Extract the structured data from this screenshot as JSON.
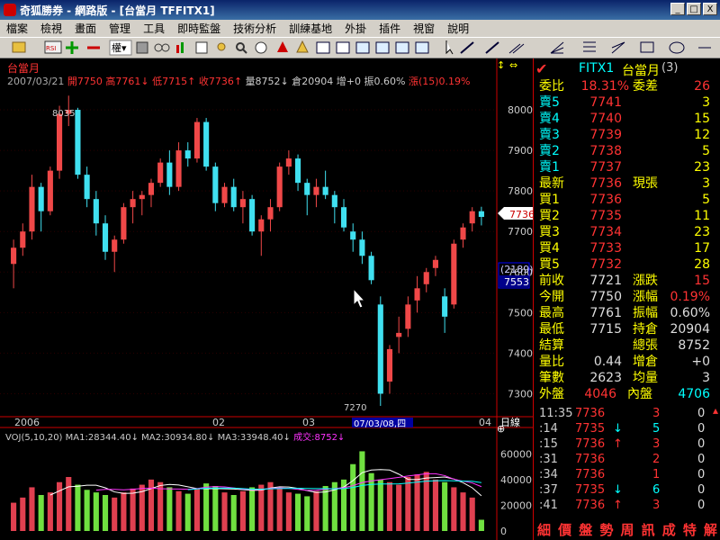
{
  "window": {
    "title": "奇狐勝券 - 網路版 - [台當月 TFFITX1]",
    "btn_min": "_",
    "btn_max": "□",
    "btn_close": "X"
  },
  "menu": {
    "items": [
      "檔案",
      "檢視",
      "畫面",
      "管理",
      "工具",
      "即時監盤",
      "技術分析",
      "訓練基地",
      "外掛",
      "插件",
      "視窗",
      "說明"
    ],
    "toolbar_select": "權▾"
  },
  "chart": {
    "product_label": "台當月",
    "info": {
      "date": "2007/03/21",
      "open": "開7750",
      "high": "高7761↓",
      "low": "低7715↑",
      "close": "收7736↑",
      "volume": "量8752↓",
      "oi": "倉20904",
      "oi_delta": "增+0",
      "amplitude": "振0.60%",
      "change": "漲(15)0.19%"
    },
    "y_labels": [
      "8000",
      "7900",
      "7800",
      "7700",
      "7600",
      "7500",
      "7400",
      "7300"
    ],
    "current_price_label": "7736",
    "diff_label": "(2189)",
    "diff_value": "7553",
    "high_mark": "8035",
    "low_mark": "7270",
    "x_labels": [
      "2006",
      "02",
      "03",
      "04"
    ],
    "cursor_date": "07/03/08,四",
    "period_label": "日線"
  },
  "volume_panel": {
    "indicator": "VOJ(5,10,20)",
    "ma1": "MA1:28344.40↓",
    "ma2": "MA2:30934.80↓",
    "ma3": "MA3:33948.40↓",
    "vol": "成交:8752↓",
    "y_labels": [
      "60000",
      "40000",
      "20000",
      "0"
    ]
  },
  "colors": {
    "up": "#f04848",
    "down": "#40e0f0",
    "vol_up": "#e04050",
    "vol_down": "#70e040"
  },
  "chart_data": {
    "type": "candlestick",
    "title": "台當月",
    "ylim": [
      7250,
      8060
    ],
    "candles": [
      [
        7620,
        7680,
        7560,
        7660
      ],
      [
        7660,
        7720,
        7640,
        7700
      ],
      [
        7700,
        7840,
        7680,
        7810
      ],
      [
        7810,
        7820,
        7700,
        7750
      ],
      [
        7750,
        7860,
        7740,
        7850
      ],
      [
        7850,
        8010,
        7830,
        7990
      ],
      [
        7990,
        8035,
        7960,
        8000
      ],
      [
        8000,
        8005,
        7830,
        7840
      ],
      [
        7840,
        7860,
        7760,
        7780
      ],
      [
        7780,
        7800,
        7690,
        7720
      ],
      [
        7720,
        7740,
        7630,
        7650
      ],
      [
        7650,
        7690,
        7600,
        7680
      ],
      [
        7680,
        7770,
        7670,
        7760
      ],
      [
        7760,
        7800,
        7720,
        7780
      ],
      [
        7780,
        7800,
        7740,
        7790
      ],
      [
        7790,
        7830,
        7760,
        7820
      ],
      [
        7820,
        7880,
        7810,
        7870
      ],
      [
        7870,
        7900,
        7790,
        7810
      ],
      [
        7810,
        7920,
        7800,
        7900
      ],
      [
        7900,
        7920,
        7860,
        7880
      ],
      [
        7880,
        7980,
        7870,
        7970
      ],
      [
        7970,
        7980,
        7850,
        7860
      ],
      [
        7860,
        7870,
        7750,
        7770
      ],
      [
        7770,
        7820,
        7760,
        7810
      ],
      [
        7810,
        7830,
        7750,
        7760
      ],
      [
        7760,
        7800,
        7720,
        7780
      ],
      [
        7780,
        7790,
        7690,
        7700
      ],
      [
        7700,
        7740,
        7640,
        7730
      ],
      [
        7730,
        7780,
        7700,
        7760
      ],
      [
        7760,
        7870,
        7750,
        7860
      ],
      [
        7860,
        7900,
        7840,
        7880
      ],
      [
        7880,
        7890,
        7800,
        7820
      ],
      [
        7820,
        7830,
        7740,
        7790
      ],
      [
        7790,
        7830,
        7760,
        7810
      ],
      [
        7810,
        7850,
        7780,
        7790
      ],
      [
        7790,
        7800,
        7720,
        7760
      ],
      [
        7760,
        7780,
        7700,
        7710
      ],
      [
        7700,
        7720,
        7650,
        7680
      ],
      [
        7680,
        7700,
        7620,
        7640
      ],
      [
        7640,
        7650,
        7570,
        7580
      ],
      [
        7520,
        7540,
        7270,
        7300
      ],
      [
        7330,
        7420,
        7300,
        7410
      ],
      [
        7440,
        7490,
        7400,
        7450
      ],
      [
        7460,
        7540,
        7440,
        7520
      ],
      [
        7530,
        7590,
        7500,
        7560
      ],
      [
        7570,
        7610,
        7550,
        7600
      ],
      [
        7610,
        7640,
        7590,
        7630
      ],
      [
        7540,
        7560,
        7450,
        7490
      ],
      [
        7520,
        7680,
        7510,
        7670
      ],
      [
        7680,
        7720,
        7660,
        7710
      ],
      [
        7720,
        7760,
        7700,
        7750
      ],
      [
        7750,
        7761,
        7715,
        7736
      ]
    ],
    "volumes": [
      22000,
      26000,
      34000,
      28000,
      30000,
      38000,
      42000,
      36000,
      32000,
      30000,
      28000,
      26000,
      30000,
      33000,
      36000,
      40000,
      38000,
      34000,
      31000,
      29000,
      33000,
      37000,
      35000,
      30000,
      28000,
      31000,
      34000,
      36000,
      38000,
      33000,
      30000,
      29000,
      27000,
      31000,
      35000,
      38000,
      40000,
      52000,
      62000,
      45000,
      40000,
      38000,
      36000,
      42000,
      44000,
      46000,
      40000,
      38000,
      34000,
      30000,
      26000,
      8752
    ]
  },
  "panel": {
    "product_code": "FITX1",
    "product_name": "台當月",
    "product_count": "(3)",
    "weibi_label": "委比",
    "weibi_value": "18.31%",
    "weicha_label": "委差",
    "weicha_value": "26",
    "asks": [
      {
        "label": "賣5",
        "price": "7741",
        "qty": "3"
      },
      {
        "label": "賣4",
        "price": "7740",
        "qty": "15"
      },
      {
        "label": "賣3",
        "price": "7739",
        "qty": "12"
      },
      {
        "label": "賣2",
        "price": "7738",
        "qty": "5"
      },
      {
        "label": "賣1",
        "price": "7737",
        "qty": "23"
      }
    ],
    "last_label": "最新",
    "last_price": "7736",
    "cur_vol_label": "現張",
    "cur_vol": "3",
    "bids": [
      {
        "label": "買1",
        "price": "7736",
        "qty": "5"
      },
      {
        "label": "買2",
        "price": "7735",
        "qty": "11"
      },
      {
        "label": "買3",
        "price": "7734",
        "qty": "23"
      },
      {
        "label": "買4",
        "price": "7733",
        "qty": "17"
      },
      {
        "label": "買5",
        "price": "7732",
        "qty": "28"
      }
    ],
    "stats": [
      {
        "l": "前收",
        "v": "7721",
        "l2": "漲跌",
        "v2": "15"
      },
      {
        "l": "今開",
        "v": "7750",
        "l2": "漲幅",
        "v2": "0.19%"
      },
      {
        "l": "最高",
        "v": "7761",
        "l2": "振幅",
        "v2": "0.60%"
      },
      {
        "l": "最低",
        "v": "7715",
        "l2": "持倉",
        "v2": "20904"
      },
      {
        "l": "結算",
        "v": "",
        "l2": "總張",
        "v2": "8752"
      },
      {
        "l": "量比",
        "v": "0.44",
        "l2": "增倉",
        "v2": "+0"
      },
      {
        "l": "筆數",
        "v": "2623",
        "l2": "均量",
        "v2": "3"
      }
    ],
    "outer_label": "外盤",
    "outer_value": "4046",
    "inner_label": "內盤",
    "inner_value": "4706",
    "ticks": [
      {
        "time": "11:35",
        "price": "7736",
        "arrow": "",
        "vol": "3",
        "x": "0"
      },
      {
        "time": ":14",
        "price": "7735",
        "arrow": "↓",
        "vol": "5",
        "x": "0"
      },
      {
        "time": ":15",
        "price": "7736",
        "arrow": "↑",
        "vol": "3",
        "x": "0"
      },
      {
        "time": ":31",
        "price": "7736",
        "arrow": "",
        "vol": "2",
        "x": "0"
      },
      {
        "time": ":34",
        "price": "7736",
        "arrow": "",
        "vol": "1",
        "x": "0"
      },
      {
        "time": ":37",
        "price": "7735",
        "arrow": "↓",
        "vol": "6",
        "x": "0"
      },
      {
        "time": ":41",
        "price": "7736",
        "arrow": "↑",
        "vol": "3",
        "x": "0"
      }
    ],
    "tabs": [
      "細",
      "價",
      "盤",
      "勢",
      "周",
      "訊",
      "成",
      "特",
      "解"
    ]
  }
}
